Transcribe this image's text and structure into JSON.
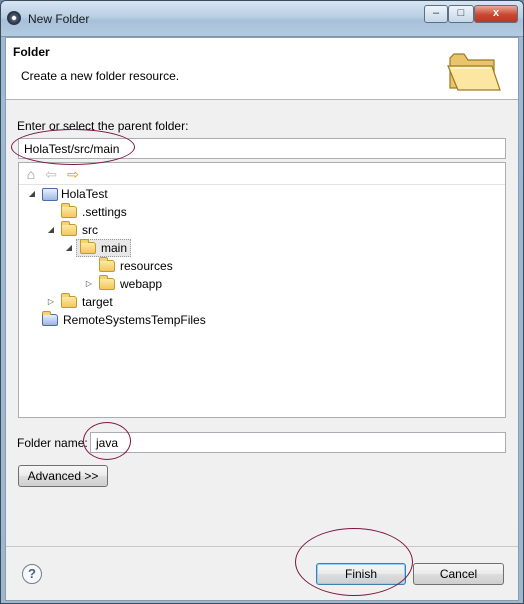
{
  "window": {
    "title": "New Folder",
    "close_glyph": "x",
    "max_glyph": "□",
    "min_glyph": "–"
  },
  "banner": {
    "title": "Folder",
    "description": "Create a new folder resource.",
    "image_icon": "folder-wizard-icon"
  },
  "parent": {
    "label": "Enter or select the parent folder:",
    "value": "HolaTest/src/main"
  },
  "tree_toolbar": [
    "home-icon",
    "back-arrow-icon",
    "forward-arrow-icon"
  ],
  "tree": [
    {
      "label": "HolaTest",
      "icon": "project-icon",
      "twisty": "expanded"
    },
    {
      "label": ".settings",
      "icon": "folder-icon",
      "twisty": "none"
    },
    {
      "label": "src",
      "icon": "folder-icon",
      "twisty": "expanded"
    },
    {
      "label": "main",
      "icon": "folder-icon",
      "twisty": "expanded",
      "selected": true
    },
    {
      "label": "resources",
      "icon": "folder-icon",
      "twisty": "none"
    },
    {
      "label": "webapp",
      "icon": "folder-icon",
      "twisty": "collapsed"
    },
    {
      "label": "target",
      "icon": "folder-icon",
      "twisty": "collapsed"
    },
    {
      "label": "RemoteSystemsTempFiles",
      "icon": "project-folder-icon",
      "twisty": "none"
    }
  ],
  "folder_name": {
    "label": "Folder name:",
    "value": "java"
  },
  "buttons": {
    "advanced": "Advanced >>",
    "finish": "Finish",
    "cancel": "Cancel",
    "help": "?"
  },
  "colors": {
    "annotation": "#7a1740",
    "selection": "#e8e8e8"
  }
}
